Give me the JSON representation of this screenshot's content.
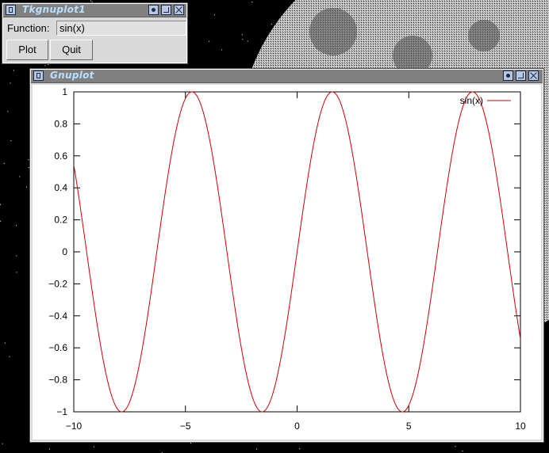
{
  "tk_window": {
    "title": "Tkgnuplot1",
    "function_label": "Function:",
    "function_value": "sin(x)",
    "plot_label": "Plot",
    "quit_label": "Quit"
  },
  "gnuplot_window": {
    "title": "Gnuplot"
  },
  "chart_data": {
    "type": "line",
    "title": "",
    "xlabel": "",
    "ylabel": "",
    "xlim": [
      -10,
      10
    ],
    "ylim": [
      -1,
      1
    ],
    "xticks": [
      -10,
      -5,
      0,
      5,
      10
    ],
    "xtick_labels": [
      "−10",
      "−5",
      "0",
      "5",
      "10"
    ],
    "yticks": [
      1,
      0.8,
      0.6,
      0.4,
      0.2,
      0,
      -0.2,
      -0.4,
      -0.6,
      -0.8,
      -1
    ],
    "ytick_labels": [
      "1",
      "0.8",
      "0.6",
      "0.4",
      "0.2",
      "0",
      "−0.2",
      "−0.4",
      "−0.6",
      "−0.8",
      "−1"
    ],
    "legend_position": "top-right",
    "grid": false,
    "series": [
      {
        "name": "sin(x)",
        "function": "sin(x)",
        "color": "#cc0000"
      }
    ]
  }
}
